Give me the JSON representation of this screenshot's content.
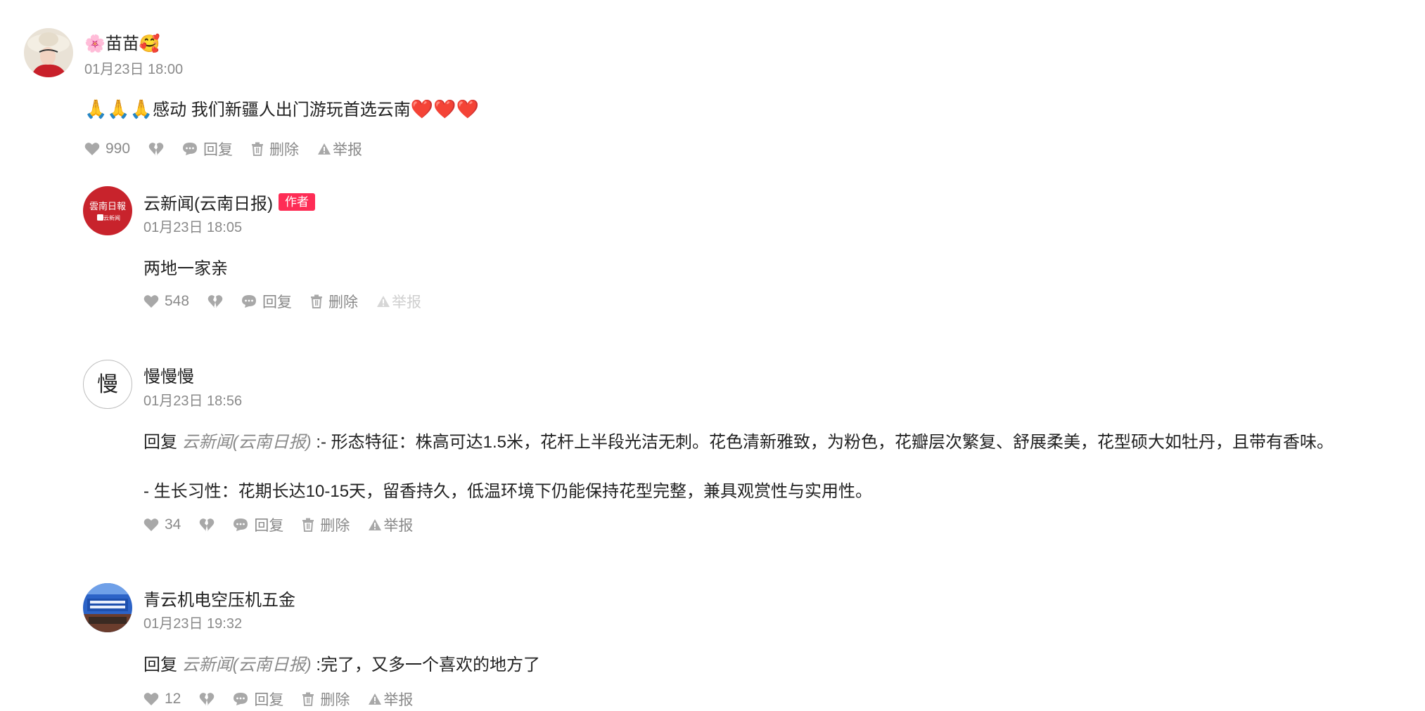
{
  "comments": [
    {
      "name_prefix": "🌸",
      "name": "苗苗",
      "name_suffix": "🥰",
      "time": "01月23日 18:00",
      "emoji_lead": "🙏🙏🙏",
      "content": "感动 我们新疆人出门游玩首选云南",
      "emoji_tail": "❤️❤️❤️",
      "likes": "990",
      "reply_label": "回复",
      "delete_label": "删除",
      "report_label": "举报"
    },
    {
      "name": "云新闻(云南日报)",
      "badge": "作者",
      "avatar_text": "雲南日報",
      "avatar_sub": "云新闻",
      "time": "01月23日 18:05",
      "content": "两地一家亲",
      "likes": "548",
      "reply_label": "回复",
      "delete_label": "删除",
      "report_label": "举报"
    },
    {
      "name": "慢慢慢",
      "avatar_text": "慢",
      "time": "01月23日 18:56",
      "reply_prefix": "回复 ",
      "reply_target": "云新闻(云南日报)",
      "content_line1": ":- 形态特征：株高可达1.5米，花杆上半段光洁无刺。花色清新雅致，为粉色，花瓣层次繁复、舒展柔美，花型硕大如牡丹，且带有香味。",
      "content_line2": "- 生长习性：花期长达10-15天，留香持久，低温环境下仍能保持花型完整，兼具观赏性与实用性。",
      "likes": "34",
      "reply_label": "回复",
      "delete_label": "删除",
      "report_label": "举报"
    },
    {
      "name": "青云机电空压机五金",
      "time": "01月23日 19:32",
      "reply_prefix": "回复 ",
      "reply_target": "云新闻(云南日报)",
      "content": ":完了，又多一个喜欢的地方了",
      "likes": "12",
      "reply_label": "回复",
      "delete_label": "删除",
      "report_label": "举报"
    }
  ],
  "colors": {
    "badge": "#fe2c55",
    "muted": "#8a8a8a",
    "text": "#222222"
  },
  "icons": {
    "like": "heart-icon",
    "dislike": "broken-heart-icon",
    "reply": "speech-bubble-icon",
    "delete": "trash-icon",
    "report": "warning-triangle-icon"
  }
}
